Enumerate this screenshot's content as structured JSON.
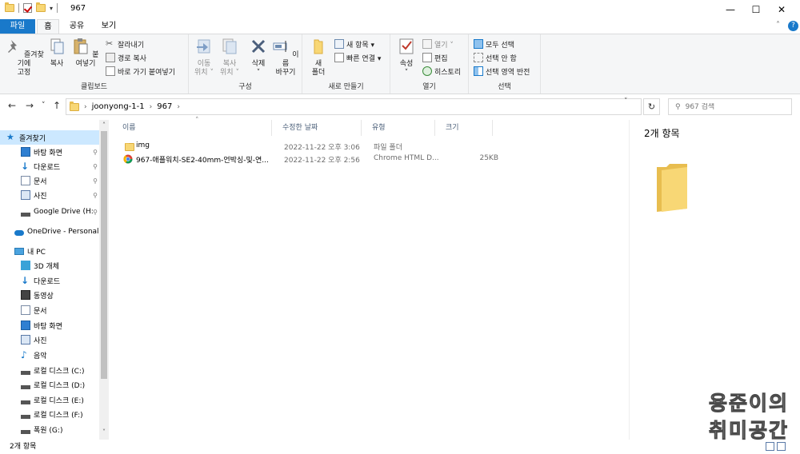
{
  "window": {
    "title": "967",
    "controls": {
      "minimize": "—",
      "maximize": "☐",
      "close": "✕"
    }
  },
  "ribbon_tabs": [
    {
      "label": "파일"
    },
    {
      "label": "홈"
    },
    {
      "label": "공유"
    },
    {
      "label": "보기"
    }
  ],
  "ribbon": {
    "clipboard": {
      "label": "클립보드",
      "pin": "즐겨찾기에\n고정",
      "copy": "복사",
      "paste": "붙여넣기",
      "cut": "잘라내기",
      "copy_path": "경로 복사",
      "paste_shortcut": "바로 가기 붙여넣기"
    },
    "organize": {
      "label": "구성",
      "move_to": "이동\n위치 ˅",
      "copy_to": "복사\n위치 ˅",
      "delete": "삭제\n˅",
      "rename": "이름\n바꾸기"
    },
    "new": {
      "label": "새로 만들기",
      "new_folder": "새\n폴더",
      "new_item": "새 항목 ▾",
      "easy_access": "빠른 연결 ▾"
    },
    "open": {
      "label": "열기",
      "properties": "속성\n˅",
      "open": "열기 ˅",
      "edit": "편집",
      "history": "히스토리"
    },
    "select": {
      "label": "선택",
      "select_all": "모두 선택",
      "select_none": "선택 안 함",
      "invert": "선택 영역 반전"
    }
  },
  "address": {
    "path": [
      "joonyong-1-1",
      "967"
    ],
    "search_placeholder": "967 검색"
  },
  "nav": {
    "quick_access": "즐겨찾기",
    "quick_items": [
      {
        "label": "바탕 화면",
        "pinned": "📌"
      },
      {
        "label": "다운로드",
        "pinned": "📌"
      },
      {
        "label": "문서",
        "pinned": "📌"
      },
      {
        "label": "사진",
        "pinned": "📌"
      },
      {
        "label": "Google Drive (H:",
        "pinned": "📌"
      }
    ],
    "onedrive": "OneDrive - Personal",
    "this_pc": "내 PC",
    "pc_items": [
      "3D 개체",
      "다운로드",
      "동영상",
      "문서",
      "바탕 화면",
      "사진",
      "음악",
      "로컬 디스크 (C:)",
      "로컬 디스크 (D:)",
      "로컬 디스크 (E:)",
      "로컬 디스크 (F:)",
      "폭원 (G:)"
    ]
  },
  "columns": {
    "name": "이름",
    "modified": "수정한 날짜",
    "type": "유형",
    "size": "크기"
  },
  "files": [
    {
      "name": "img",
      "modified": "2022-11-22 오후 3:06",
      "type": "파일 폴더",
      "size": "",
      "icon": "folder-icon"
    },
    {
      "name": "967-애플워치-SE2-40mm-언박싱-및-연...",
      "modified": "2022-11-22 오후 2:56",
      "type": "Chrome HTML D...",
      "size": "25KB",
      "icon": "chrome-icon"
    }
  ],
  "preview": {
    "count": "2개 항목"
  },
  "status": {
    "count": "2개 항목"
  },
  "watermark": {
    "line1": "용준이의",
    "line2": "취미공간"
  },
  "colors": {
    "accent": "#1979ca",
    "selection": "#cce8ff",
    "folder": "#f8d775"
  }
}
